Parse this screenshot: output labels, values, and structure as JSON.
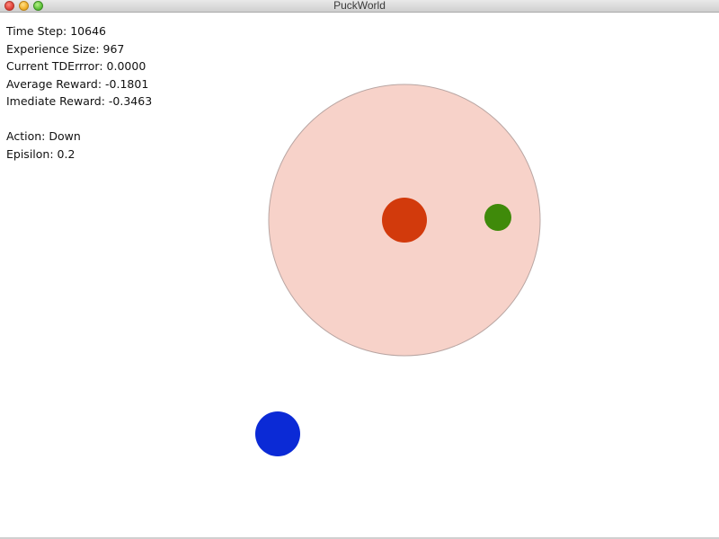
{
  "window": {
    "title": "PuckWorld"
  },
  "stats": {
    "time_step": "Time Step: 10646",
    "experience_size": "Experience Size: 967",
    "td_error": "Current TDErrror: 0.0000",
    "average_reward": "Average Reward: -0.1801",
    "immediate_reward": "Imediate Reward: -0.3463",
    "action": "Action: Down",
    "epsilon": "Episilon: 0.2"
  },
  "colors": {
    "danger_zone_fill": "#f7d2c9",
    "danger_zone_stroke": "#b9a6a3",
    "enemy": "#d23a0c",
    "target": "#3f8a0a",
    "agent": "#0b2ad6"
  },
  "icons": {
    "close": "close-icon",
    "minimize": "minimize-icon",
    "maximize": "maximize-icon"
  }
}
